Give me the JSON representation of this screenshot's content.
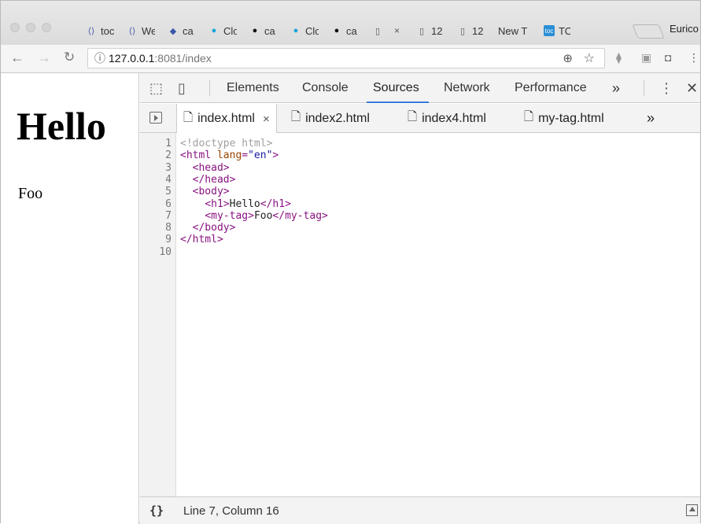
{
  "browser": {
    "tabs": [
      {
        "title": "toc",
        "icon": "logo-icon",
        "color": "#3b57a8",
        "glyph": "⟨⟩"
      },
      {
        "title": "We",
        "icon": "logo-icon",
        "color": "#3b57a8",
        "glyph": "⟨⟩"
      },
      {
        "title": "ca",
        "icon": "logo-icon",
        "color": "#3b57a8",
        "glyph": "◆"
      },
      {
        "title": "Clo",
        "icon": "cloud-icon",
        "color": "#16a3dc",
        "glyph": "●"
      },
      {
        "title": "ca",
        "icon": "github-icon",
        "color": "#111111",
        "glyph": "●"
      },
      {
        "title": "Clo",
        "icon": "cloud-icon",
        "color": "#16a3dc",
        "glyph": "●"
      },
      {
        "title": "ca",
        "icon": "github-icon",
        "color": "#111111",
        "glyph": "●"
      },
      {
        "title": "",
        "icon": "document-icon",
        "color": "#555555",
        "glyph": "▯",
        "close": "×",
        "active": true
      },
      {
        "title": "12",
        "icon": "document-icon",
        "color": "#555555",
        "glyph": "▯"
      },
      {
        "title": "12",
        "icon": "document-icon",
        "color": "#555555",
        "glyph": "▯"
      },
      {
        "title": "New T",
        "icon": "",
        "color": "",
        "glyph": ""
      },
      {
        "title": "TO",
        "icon": "toc-icon",
        "color": "#2a8fd6",
        "glyph": "toc"
      }
    ],
    "profile": "Eurico",
    "address": {
      "host": "127.0.0.1",
      "rest": ":8081/index"
    }
  },
  "page": {
    "heading": "Hello",
    "custom_tag_text": "Foo"
  },
  "devtools": {
    "tabs": [
      "Elements",
      "Console",
      "Sources",
      "Network",
      "Performance"
    ],
    "active_tab": "Sources",
    "more": "»",
    "files": [
      {
        "name": "index.html",
        "close": "×",
        "active": true
      },
      {
        "name": "index2.html"
      },
      {
        "name": "index4.html"
      },
      {
        "name": "my-tag.html"
      }
    ],
    "files_more": "»",
    "code_lines": [
      {
        "n": "1",
        "code": "<!doctype html>"
      },
      {
        "n": "2",
        "code": "<html lang=\"en\">"
      },
      {
        "n": "3",
        "code": "  <head>"
      },
      {
        "n": "4",
        "code": "  </head>"
      },
      {
        "n": "5",
        "code": "  <body>"
      },
      {
        "n": "6",
        "code": "    <h1>Hello</h1>"
      },
      {
        "n": "7",
        "code": "    <my-tag>Foo</my-tag>"
      },
      {
        "n": "8",
        "code": "  </body>"
      },
      {
        "n": "9",
        "code": "</html>"
      },
      {
        "n": "10",
        "code": ""
      }
    ],
    "status": {
      "braces": "{}",
      "position": "Line 7, Column 16"
    }
  }
}
